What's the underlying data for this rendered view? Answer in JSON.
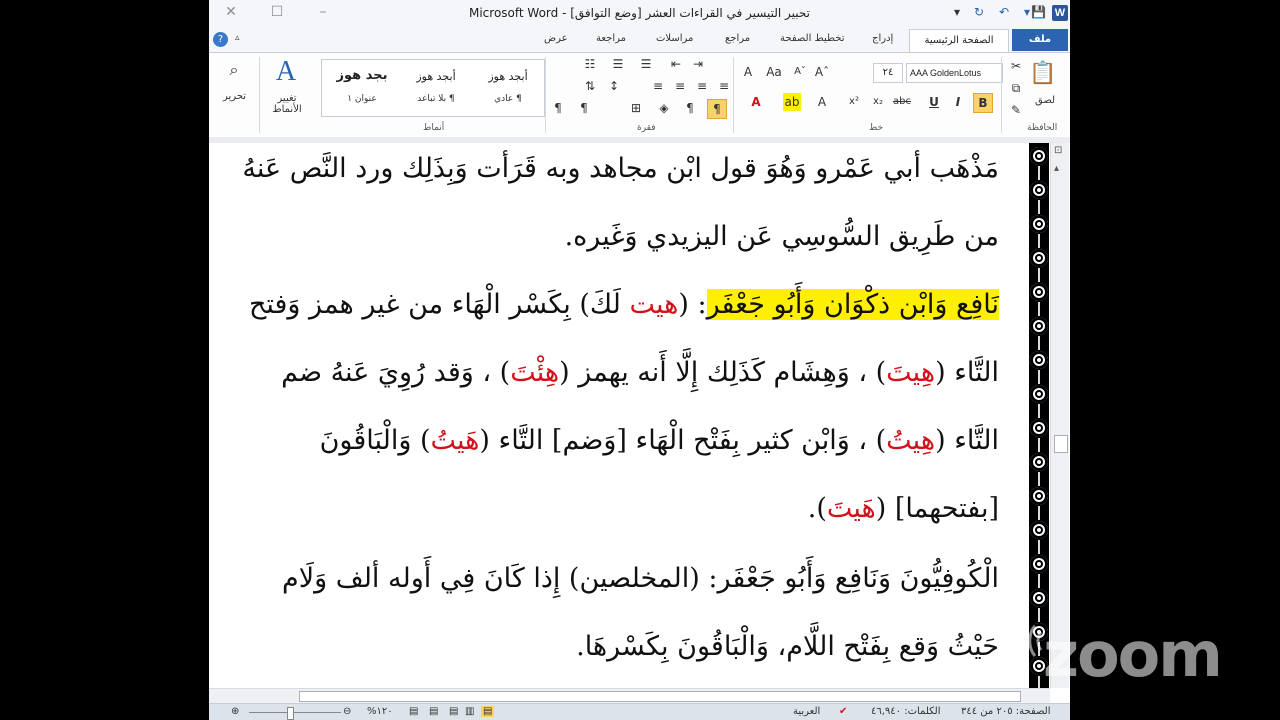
{
  "window": {
    "title": "تحبير التيسير في القراءات العشر [وضع التوافق] - Microsoft Word",
    "logo": "W"
  },
  "tabs": {
    "file": "ملف",
    "home": "الصفحة الرئيسية",
    "insert": "إدراج",
    "page_layout": "تخطيط الصفحة",
    "references": "مراجع",
    "mailings": "مراسلات",
    "review": "مراجعة",
    "view": "عرض"
  },
  "ribbon": {
    "clipboard": {
      "group": "الحافظة",
      "paste": "لصق"
    },
    "font": {
      "group": "خط",
      "name": "AAA GoldenLotus",
      "size": "٢٤"
    },
    "paragraph": {
      "group": "فقرة"
    },
    "styles": {
      "group": "أنماط",
      "items": [
        {
          "preview": "أبجد هوز",
          "name": "¶ عادي"
        },
        {
          "preview": "أبجد هوز",
          "name": "¶ بلا تباعد"
        },
        {
          "preview": "بجد هوز",
          "name": "عنوان ١"
        }
      ],
      "change": "تغيير الأنماط"
    },
    "editing": {
      "label": "تحرير"
    }
  },
  "document": {
    "lines": [
      [
        {
          "t": "مَذْهَب أبي عَمْرو وَهُوَ قول ابْن مجاهد وبه قَرَأت وَبِذَلِك ورد النَّص عَنهُ"
        }
      ],
      [
        {
          "t": "من طَرِيق السُّوسِي عَن اليزيدي وَغَيره."
        }
      ],
      [
        {
          "t": "نَافِع وَابْن ذكْوَان وَأَبُو جَعْفَر",
          "hl": true
        },
        {
          "t": ": ("
        },
        {
          "t": "هيت",
          "red": true
        },
        {
          "t": " لَكَ) بِكَسْر الْهَاء من غير همز وَفتح"
        }
      ],
      [
        {
          "t": "التَّاء ("
        },
        {
          "t": "هِيتَ",
          "red": true
        },
        {
          "t": ") ، وَهِشَام كَذَلِك إِلَّا أَنه يهمز ("
        },
        {
          "t": "هِئْتَ",
          "red": true
        },
        {
          "t": ") ، وَقد رُوِيَ عَنهُ ضم"
        }
      ],
      [
        {
          "t": "التَّاء ("
        },
        {
          "t": "هِيتُ",
          "red": true
        },
        {
          "t": ") ، وَابْن كثير بِفَتْح الْهَاء [وَضم] التَّاء ("
        },
        {
          "t": "هَيتُ",
          "red": true
        },
        {
          "t": ")  وَالْبَاقُونَ"
        }
      ],
      [
        {
          "t": "[بفتحهما] ("
        },
        {
          "t": "هَيتَ",
          "red": true
        },
        {
          "t": ")."
        }
      ],
      [
        {
          "t": "الْكُوفِيُّونَ وَنَافِع وَأَبُو جَعْفَر: (المخلصين) إِذا كَانَ فِي أَوله ألف وَلَام"
        }
      ],
      [
        {
          "t": "حَيْثُ وَقع بِفَتْح اللَّام، وَالْبَاقُونَ بِكَسْرهَا."
        }
      ]
    ]
  },
  "status": {
    "page": "الصفحة: ٢٠٥ من ٣٤٤",
    "words": "الكلمات: ٤٦,٩٤٠",
    "language": "العربية",
    "zoom": "١٢٠%"
  },
  "watermark": {
    "text": "zoom"
  },
  "colors": {
    "accent": "#2b64b0",
    "highlight": "#ffef00",
    "red_text": "#d1121b"
  }
}
